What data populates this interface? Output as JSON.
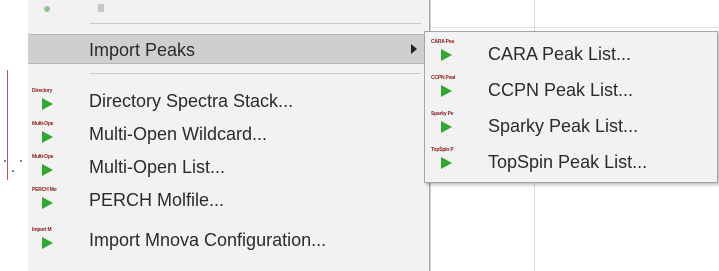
{
  "colors": {
    "menu_bg": "#f2f2f2",
    "highlight_bg": "#cfcfcf",
    "text": "#2b2b2b",
    "icon_play": "#2fa82f",
    "icon_caption": "#8b1a1a"
  },
  "menu": {
    "highlighted": {
      "label": "Import Peaks",
      "icon": "none",
      "has_submenu": true
    },
    "items": [
      {
        "label": "Directory Spectra Stack...",
        "icon_caption": "Directory",
        "icon": "play-icon"
      },
      {
        "label": "Multi-Open Wildcard...",
        "icon_caption": "Multi-Ope",
        "icon": "play-icon"
      },
      {
        "label": "Multi-Open List...",
        "icon_caption": "Multi-Ope",
        "icon": "play-icon"
      },
      {
        "label": "PERCH Molfile...",
        "icon_caption": "PERCH Mo",
        "icon": "play-icon"
      },
      {
        "label": "Import Mnova Configuration...",
        "icon_caption": "Import M",
        "icon": "play-icon"
      }
    ]
  },
  "submenu": {
    "items": [
      {
        "label": "CARA Peak List...",
        "icon_caption": "CARA Pea",
        "icon": "play-icon"
      },
      {
        "label": "CCPN Peak List...",
        "icon_caption": "CCPN Peal",
        "icon": "play-icon"
      },
      {
        "label": "Sparky Peak List...",
        "icon_caption": "Sparky Pe",
        "icon": "play-icon"
      },
      {
        "label": "TopSpin Peak List...",
        "icon_caption": "TopSpin P",
        "icon": "play-icon"
      }
    ]
  }
}
